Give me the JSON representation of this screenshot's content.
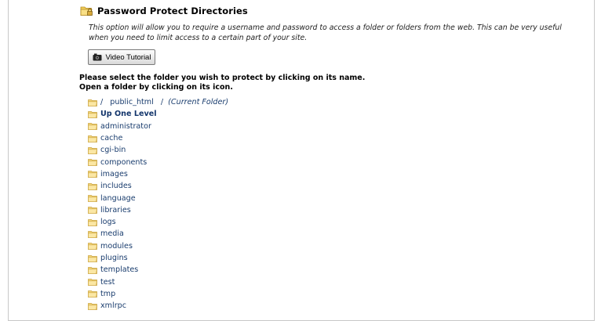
{
  "header": {
    "title": "Password Protect Directories",
    "icon": "folder-lock-icon"
  },
  "description": "This option will allow you to require a username and password to access a folder or folders from the web. This can be very useful when you need to limit access to a certain part of your site.",
  "video_button": {
    "label": "Video Tutorial",
    "icon": "video-camera-icon"
  },
  "instructions": {
    "line1": "Please select the folder you wish to protect by clicking on its name.",
    "line2": "Open a folder by clicking on its icon."
  },
  "current_path": {
    "root": "/",
    "folder": "public_html",
    "separator": "/",
    "note": "(Current Folder)"
  },
  "up_level": "Up One Level",
  "folders": [
    "administrator",
    "cache",
    "cgi-bin",
    "components",
    "images",
    "includes",
    "language",
    "libraries",
    "logs",
    "media",
    "modules",
    "plugins",
    "templates",
    "test",
    "tmp",
    "xmlrpc"
  ],
  "colors": {
    "link": "#1a3d6e",
    "folder": "#f4d67a",
    "folder_outline": "#c9a23c"
  }
}
